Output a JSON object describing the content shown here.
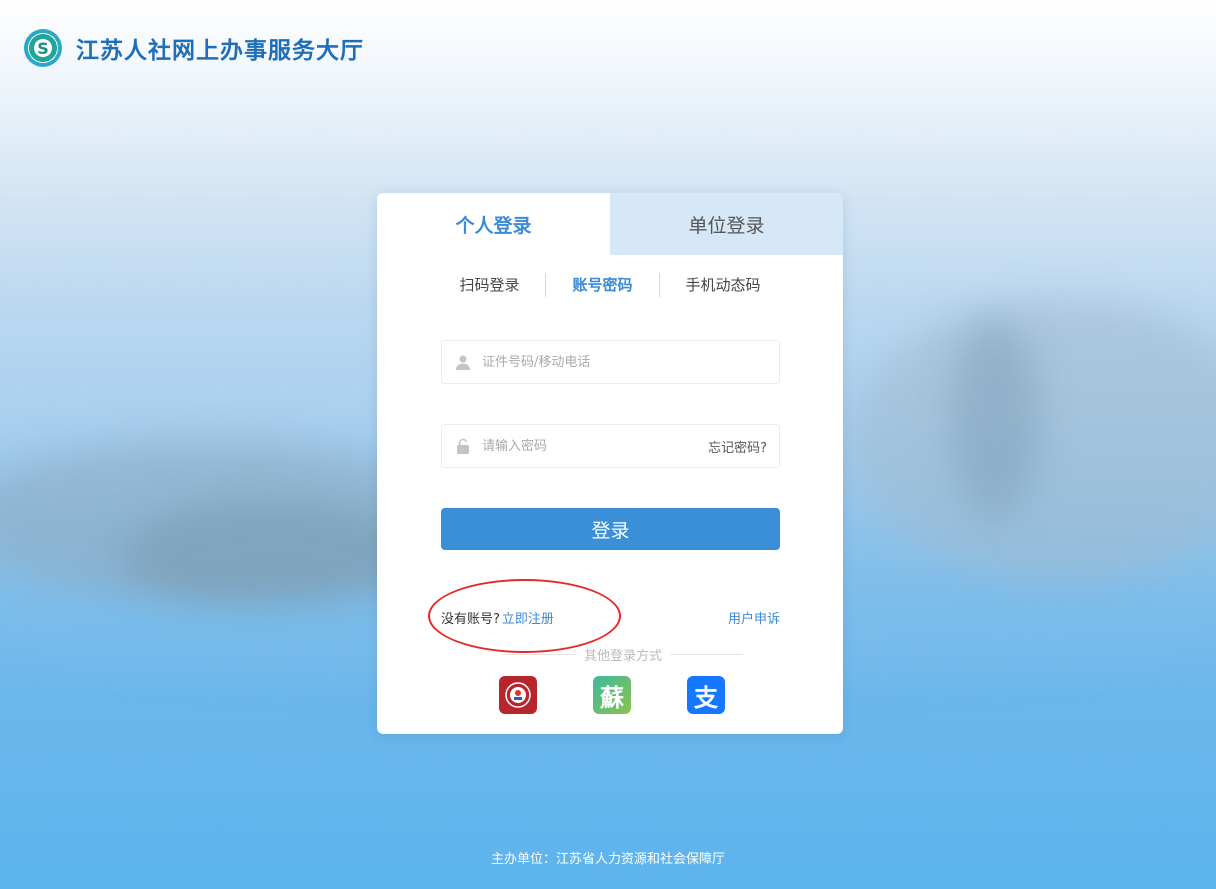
{
  "header": {
    "title": "江苏人社网上办事服务大厅",
    "logo_icon": "social-security-logo-icon"
  },
  "login_tabs": [
    {
      "label": "个人登录",
      "active": true
    },
    {
      "label": "单位登录",
      "active": false
    }
  ],
  "sub_tabs": [
    {
      "label": "扫码登录",
      "active": false
    },
    {
      "label": "账号密码",
      "active": true
    },
    {
      "label": "手机动态码",
      "active": false
    }
  ],
  "form": {
    "username_placeholder": "证件号码/移动电话",
    "password_placeholder": "请输入密码",
    "forgot_label": "忘记密码?",
    "login_label": "登录"
  },
  "links": {
    "no_account": "没有账号?",
    "register": "立即注册",
    "complaint": "用户申诉"
  },
  "other_login": {
    "label": "其他登录方式",
    "apps": [
      {
        "icon": "government-app-icon"
      },
      {
        "icon": "su-app-icon",
        "glyph": "蘇"
      },
      {
        "icon": "alipay-icon",
        "glyph": "支"
      }
    ]
  },
  "footer": {
    "text": "主办单位：江苏省人力资源和社会保障厅"
  },
  "colors": {
    "accent": "#3b8bd6",
    "button": "#3a8fd8",
    "highlight_oval": "#e22b2b"
  }
}
